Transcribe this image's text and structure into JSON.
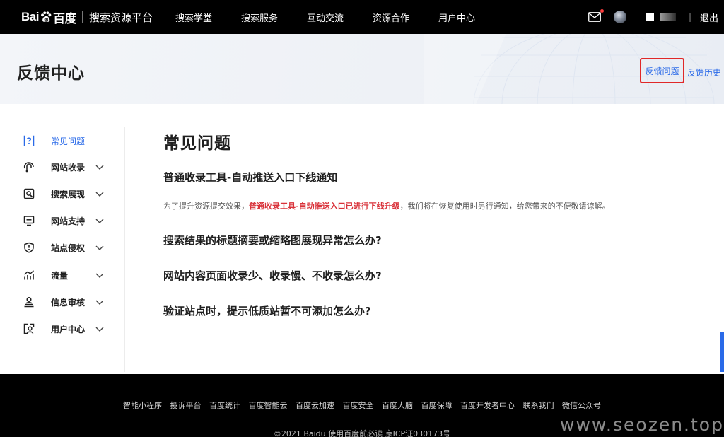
{
  "header": {
    "logo_text_left": "Bai",
    "logo_text_right": "百度",
    "logo_subtitle": "搜索资源平台",
    "nav": [
      "搜索学堂",
      "搜索服务",
      "互动交流",
      "资源合作",
      "用户中心"
    ],
    "logout": "退出",
    "separator": "|",
    "icons": [
      "mail-icon",
      "avatar"
    ],
    "accent_dot_color": "#ff3d3d"
  },
  "banner": {
    "title": "反馈中心",
    "feedback_link": "反馈问题",
    "history_link": "反馈历史",
    "link_color": "#2a6ae8",
    "highlight_border_color": "#e02828"
  },
  "sidebar": {
    "items": [
      {
        "label": "常见问题",
        "icon": "help-icon",
        "active": true
      },
      {
        "label": "网站收录",
        "icon": "index-icon",
        "expandable": true
      },
      {
        "label": "搜索展现",
        "icon": "search-display-icon",
        "expandable": true
      },
      {
        "label": "网站支持",
        "icon": "monitor-icon",
        "expandable": true
      },
      {
        "label": "站点侵权",
        "icon": "shield-icon",
        "expandable": true
      },
      {
        "label": "流量",
        "icon": "traffic-chart-icon",
        "expandable": true
      },
      {
        "label": "信息审核",
        "icon": "review-icon",
        "expandable": true
      },
      {
        "label": "用户中心",
        "icon": "user-center-icon",
        "expandable": true
      }
    ]
  },
  "main": {
    "title": "常见问题",
    "questions": [
      {
        "title": "普通收录工具-自动推送入口下线通知",
        "desc_before": "为了提升资源提交效果，",
        "desc_highlight": "普通收录工具-自动推送入口已进行下线升级",
        "desc_after": "，我们将在恢复使用时另行通知，给您带来的不便敬请谅解。"
      },
      {
        "title": "搜索结果的标题摘要或缩略图展现异常怎么办?"
      },
      {
        "title": "网站内容页面收录少、收录慢、不收录怎么办?"
      },
      {
        "title": "验证站点时，提示低质站暂不可添加怎么办?"
      }
    ]
  },
  "footer": {
    "links": [
      "智能小程序",
      "投诉平台",
      "百度统计",
      "百度智能云",
      "百度云加速",
      "百度安全",
      "百度大脑",
      "百度保障",
      "百度开发者中心",
      "联系我们",
      "微信公众号"
    ],
    "copyright": "©2021 Baidu 使用百度前必读 京ICP证030173号"
  },
  "watermark": "www.seozen.top"
}
